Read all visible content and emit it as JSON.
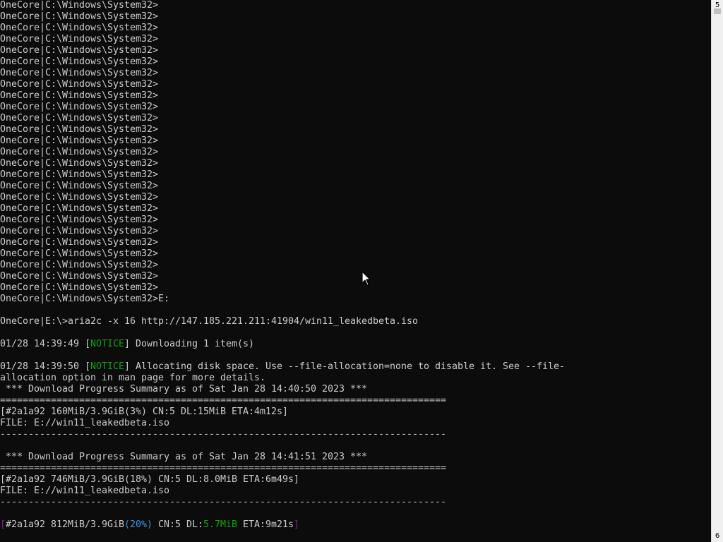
{
  "console": {
    "prompt_lines": [
      "OneCore|C:\\Windows\\System32>",
      "OneCore|C:\\Windows\\System32>",
      "OneCore|C:\\Windows\\System32>",
      "OneCore|C:\\Windows\\System32>",
      "OneCore|C:\\Windows\\System32>",
      "OneCore|C:\\Windows\\System32>",
      "OneCore|C:\\Windows\\System32>",
      "OneCore|C:\\Windows\\System32>",
      "OneCore|C:\\Windows\\System32>",
      "OneCore|C:\\Windows\\System32>",
      "OneCore|C:\\Windows\\System32>",
      "OneCore|C:\\Windows\\System32>",
      "OneCore|C:\\Windows\\System32>",
      "OneCore|C:\\Windows\\System32>",
      "OneCore|C:\\Windows\\System32>",
      "OneCore|C:\\Windows\\System32>",
      "OneCore|C:\\Windows\\System32>",
      "OneCore|C:\\Windows\\System32>",
      "OneCore|C:\\Windows\\System32>",
      "OneCore|C:\\Windows\\System32>",
      "OneCore|C:\\Windows\\System32>",
      "OneCore|C:\\Windows\\System32>",
      "OneCore|C:\\Windows\\System32>",
      "OneCore|C:\\Windows\\System32>",
      "OneCore|C:\\Windows\\System32>",
      "OneCore|C:\\Windows\\System32>",
      "OneCore|C:\\Windows\\System32>E:"
    ],
    "output_lines": [
      [
        {
          "t": ""
        }
      ],
      [
        {
          "t": "OneCore|E:\\>aria2c -x 16 http://147.185.221.211:41904/win11_leakedbeta.iso"
        }
      ],
      [
        {
          "t": ""
        }
      ],
      [
        {
          "t": "01/28 14:39:49 ["
        },
        {
          "t": "NOTICE",
          "c": "notice"
        },
        {
          "t": "] Downloading 1 item(s)"
        }
      ],
      [
        {
          "t": ""
        }
      ],
      [
        {
          "t": "01/28 14:39:50 ["
        },
        {
          "t": "NOTICE",
          "c": "notice"
        },
        {
          "t": "] Allocating disk space. Use --file-allocation=none to disable it. See --file-"
        }
      ],
      [
        {
          "t": "allocation option in man page for more details."
        }
      ],
      [
        {
          "t": " *** Download Progress Summary as of Sat Jan 28 14:40:50 2023 ***"
        }
      ],
      [
        {
          "t": "==============================================================================="
        }
      ],
      [
        {
          "t": "[#2a1a92 160MiB/3.9GiB(3%) CN:5 DL:15MiB ETA:4m12s]"
        }
      ],
      [
        {
          "t": "FILE: E://win11_leakedbeta.iso"
        }
      ],
      [
        {
          "t": "-------------------------------------------------------------------------------"
        }
      ],
      [
        {
          "t": ""
        }
      ],
      [
        {
          "t": " *** Download Progress Summary as of Sat Jan 28 14:41:51 2023 ***"
        }
      ],
      [
        {
          "t": "==============================================================================="
        }
      ],
      [
        {
          "t": "[#2a1a92 746MiB/3.9GiB(18%) CN:5 DL:8.0MiB ETA:6m49s]"
        }
      ],
      [
        {
          "t": "FILE: E://win11_leakedbeta.iso"
        }
      ],
      [
        {
          "t": "-------------------------------------------------------------------------------"
        }
      ],
      [
        {
          "t": ""
        }
      ],
      [
        {
          "t": "[",
          "c": "bracket"
        },
        {
          "t": "#2a1a92 812MiB/3.9GiB"
        },
        {
          "t": "(20%)",
          "c": "pct"
        },
        {
          "t": " CN:5 DL:"
        },
        {
          "t": "5.7MiB",
          "c": "speed"
        },
        {
          "t": " ETA:9m21s"
        },
        {
          "t": "]",
          "c": "bracket"
        }
      ]
    ]
  },
  "scrollbar": {
    "top_marker": "5",
    "bottom_marker": "6"
  },
  "colors": {
    "background": "#0c0c0c",
    "text": "#cccccc",
    "notice": "#13a10e",
    "bracket": "#881798",
    "percent": "#3a96dd",
    "speed": "#13a10e"
  },
  "icons": {
    "cursor": "mouse-pointer-icon"
  }
}
